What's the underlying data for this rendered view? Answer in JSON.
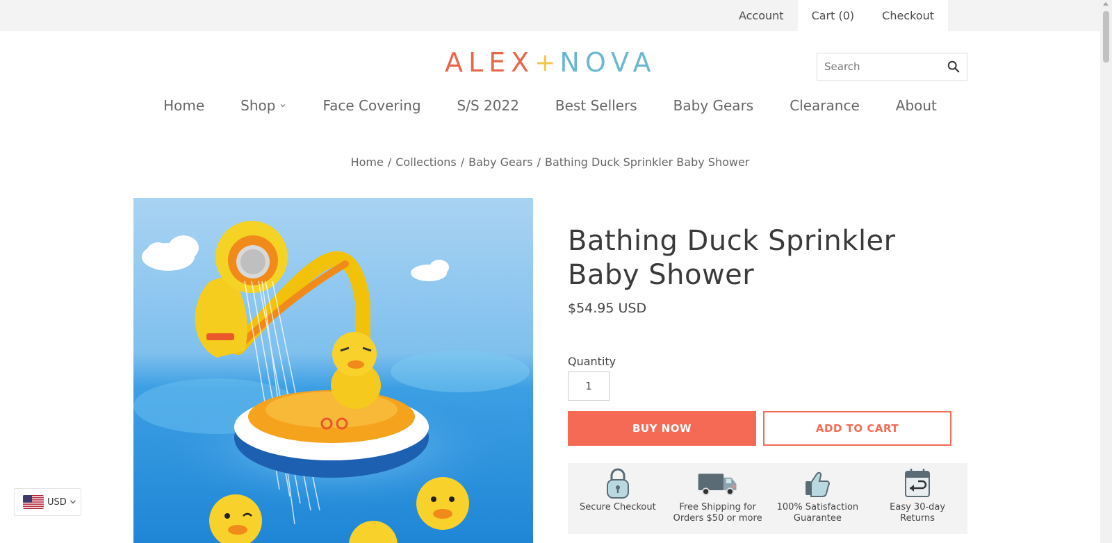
{
  "top_links": [
    {
      "label": "Account"
    },
    {
      "label": "Cart (0)"
    },
    {
      "label": "Checkout"
    }
  ],
  "logo": {
    "part1": "ALEX",
    "plus": "+",
    "part2": "NOVA"
  },
  "search": {
    "placeholder": "Search"
  },
  "nav": [
    {
      "label": "Home"
    },
    {
      "label": "Shop"
    },
    {
      "label": "Face Covering"
    },
    {
      "label": "S/S 2022"
    },
    {
      "label": "Best Sellers"
    },
    {
      "label": "Baby Gears"
    },
    {
      "label": "Clearance"
    },
    {
      "label": "About"
    }
  ],
  "breadcrumb": [
    {
      "label": "Home"
    },
    {
      "label": "Collections"
    },
    {
      "label": "Baby Gears"
    },
    {
      "label": "Bathing Duck Sprinkler Baby Shower"
    }
  ],
  "breadcrumb_sep": "/",
  "product": {
    "title": "Bathing Duck Sprinkler Baby Shower",
    "price": "$54.95 USD",
    "quantity_label": "Quantity",
    "quantity_value": "1",
    "buy_now_label": "BUY NOW",
    "add_to_cart_label": "ADD TO CART"
  },
  "badges": [
    {
      "line1": "Secure Checkout",
      "line2": "",
      "icon": "lock-icon"
    },
    {
      "line1": "Free Shipping for",
      "line2": "Orders $50 or more",
      "icon": "truck-icon"
    },
    {
      "line1": "100% Satisfaction",
      "line2": "Guarantee",
      "icon": "thumbs-up-icon"
    },
    {
      "line1": "Easy 30-day",
      "line2": "Returns",
      "icon": "calendar-return-icon"
    }
  ],
  "currency": {
    "label": "USD"
  },
  "colors": {
    "accent": "#f56a54",
    "logo_orange": "#e8664a",
    "logo_yellow": "#f2c64c",
    "logo_blue": "#6ab8d0",
    "topbar": "#f3f3f3"
  }
}
